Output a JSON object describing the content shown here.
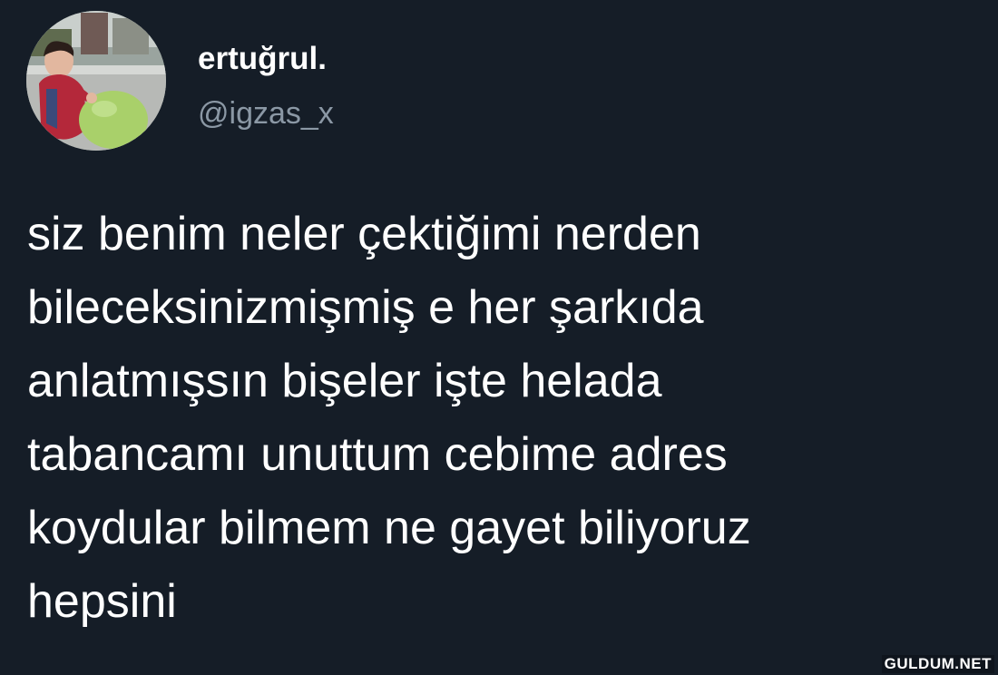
{
  "tweet": {
    "display_name": "ertuğrul.",
    "handle": "@igzas_x",
    "avatar_icon": "profile-photo",
    "body_lines": [
      "siz benim neler çektiğimi nerden",
      "bileceksinizmişmiş e her şarkıda",
      "anlatmışsın bişeler işte helada",
      "tabancamı unuttum cebime adres",
      "koydular bilmem ne gayet biliyoruz",
      "hepsini"
    ]
  },
  "watermark": "GULDUM.NET",
  "colors": {
    "background": "#151d27",
    "name": "#ffffff",
    "handle": "#8b98a5",
    "text": "#ffffff"
  }
}
